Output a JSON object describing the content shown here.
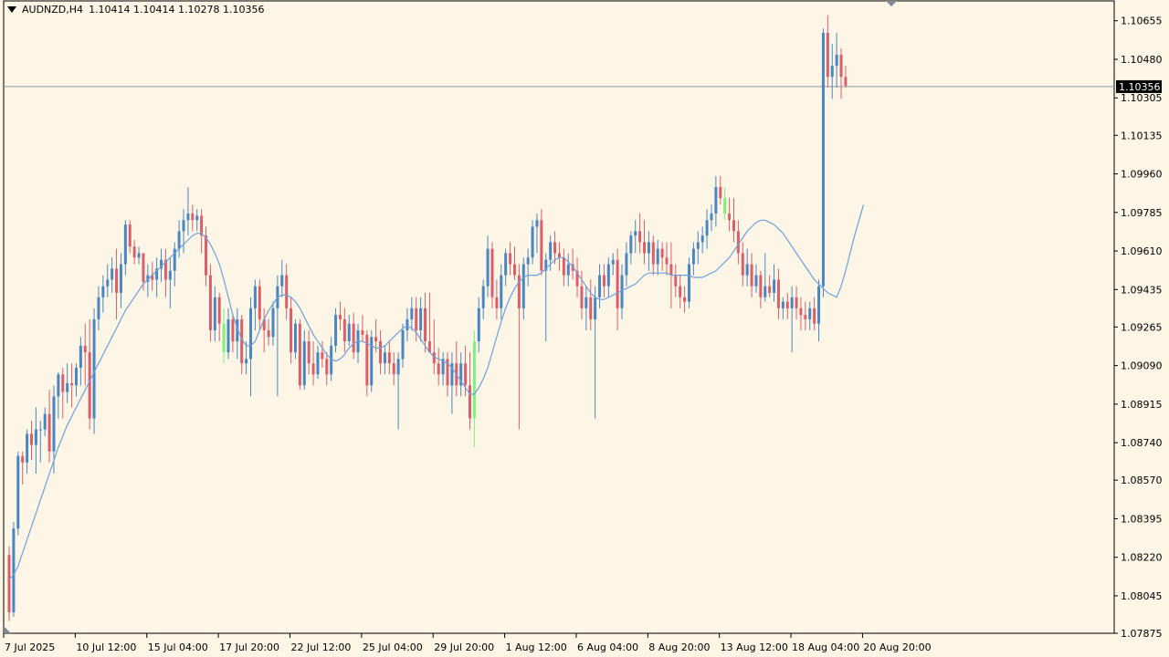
{
  "header": {
    "symbol": "AUDNZD,H4",
    "ohlc": "1.10414 1.10414 1.10278 1.10356"
  },
  "colors": {
    "background": "#fdf5e6",
    "bull": "#4a86c0",
    "bear": "#d9606a",
    "highlight": "#7ef07e",
    "ma_line": "#6fa0dc",
    "price_line": "#8a9aa8"
  },
  "chart_data": {
    "type": "candlestick",
    "title": "AUDNZD,H4",
    "current_price": "1.10356",
    "ylim": [
      1.07875,
      1.10745
    ],
    "y_ticks": [
      "1.10655",
      "1.10480",
      "1.10305",
      "1.10135",
      "1.09960",
      "1.09785",
      "1.09610",
      "1.09435",
      "1.09265",
      "1.09090",
      "1.08915",
      "1.08740",
      "1.08570",
      "1.08395",
      "1.08220",
      "1.08045",
      "1.07875"
    ],
    "x_tick_labels": [
      "7 Jul 2025",
      "10 Jul 12:00",
      "15 Jul 04:00",
      "17 Jul 20:00",
      "22 Jul 12:00",
      "25 Jul 04:00",
      "29 Jul 20:00",
      "1 Aug 12:00",
      "6 Aug 04:00",
      "8 Aug 20:00",
      "13 Aug 12:00",
      "18 Aug 04:00",
      "20 Aug 20:00"
    ],
    "x_tick_bars": [
      0,
      16,
      32,
      48,
      64,
      80,
      96,
      112,
      128,
      144,
      160,
      176,
      192
    ],
    "candles": [
      [
        1.0823,
        1.0827,
        1.0793,
        1.0797
      ],
      [
        1.0797,
        1.0838,
        1.0795,
        1.0835
      ],
      [
        1.0835,
        1.087,
        1.0832,
        1.0868
      ],
      [
        1.0868,
        1.087,
        1.0855,
        1.0865
      ],
      [
        1.0865,
        1.088,
        1.086,
        1.0878
      ],
      [
        1.0878,
        1.0884,
        1.0866,
        1.0873
      ],
      [
        1.0873,
        1.089,
        1.086,
        1.088
      ],
      [
        1.088,
        1.0884,
        1.0865,
        1.088
      ],
      [
        1.088,
        1.089,
        1.0877,
        1.0887
      ],
      [
        1.0887,
        1.0898,
        1.0865,
        1.087
      ],
      [
        1.087,
        1.09,
        1.086,
        1.0895
      ],
      [
        1.0895,
        1.0906,
        1.0885,
        1.0905
      ],
      [
        1.0905,
        1.0908,
        1.0885,
        1.0897
      ],
      [
        1.0897,
        1.091,
        1.0892,
        1.0901
      ],
      [
        1.0901,
        1.091,
        1.089,
        1.09
      ],
      [
        1.09,
        1.091,
        1.0895,
        1.0908
      ],
      [
        1.0908,
        1.0922,
        1.09,
        1.0918
      ],
      [
        1.0918,
        1.0928,
        1.09,
        1.0915
      ],
      [
        1.0915,
        1.093,
        1.088,
        1.0885
      ],
      [
        1.0885,
        1.0935,
        1.0878,
        1.093
      ],
      [
        1.093,
        1.0945,
        1.0925,
        1.094
      ],
      [
        1.094,
        1.095,
        1.0933,
        1.0945
      ],
      [
        1.0945,
        1.0955,
        1.094,
        1.0948
      ],
      [
        1.0948,
        1.0958,
        1.0942,
        1.0953
      ],
      [
        1.0953,
        1.0962,
        1.093,
        1.0942
      ],
      [
        1.0942,
        1.096,
        1.0935,
        1.0955
      ],
      [
        1.0955,
        1.0975,
        1.095,
        1.0973
      ],
      [
        1.0973,
        1.0975,
        1.096,
        1.0963
      ],
      [
        1.0963,
        1.0966,
        1.0955,
        1.0958
      ],
      [
        1.0958,
        1.0963,
        1.0955,
        1.096
      ],
      [
        1.096,
        1.096,
        1.0943,
        1.0947
      ],
      [
        1.0947,
        1.0955,
        1.094,
        1.095
      ],
      [
        1.095,
        1.0956,
        1.0943,
        1.0948
      ],
      [
        1.0948,
        1.0958,
        1.094,
        1.0953
      ],
      [
        1.0953,
        1.0962,
        1.0947,
        1.0957
      ],
      [
        1.0957,
        1.0962,
        1.094,
        1.0948
      ],
      [
        1.0948,
        1.0958,
        1.0935,
        1.0952
      ],
      [
        1.0952,
        1.0965,
        1.0945,
        1.0962
      ],
      [
        1.0962,
        1.0975,
        1.0958,
        1.097
      ],
      [
        1.097,
        1.098,
        1.096,
        1.0975
      ],
      [
        1.0975,
        1.099,
        1.0968,
        1.0978
      ],
      [
        1.0978,
        1.0982,
        1.097,
        1.0975
      ],
      [
        1.0975,
        1.098,
        1.097,
        1.0977
      ],
      [
        1.0977,
        1.098,
        1.096,
        1.0968
      ],
      [
        1.0968,
        1.0972,
        1.0945,
        1.095
      ],
      [
        1.095,
        1.0955,
        1.092,
        1.0925
      ],
      [
        1.0925,
        1.0945,
        1.092,
        1.094
      ],
      [
        1.094,
        1.0942,
        1.092,
        1.0928
      ],
      [
        1.0928,
        1.0935,
        1.091,
        1.0915
      ],
      [
        1.0915,
        1.0935,
        1.0912,
        1.093
      ],
      [
        1.093,
        1.0932,
        1.0915,
        1.092
      ],
      [
        1.092,
        1.0935,
        1.0912,
        1.093
      ],
      [
        1.093,
        1.0932,
        1.0905,
        1.091
      ],
      [
        1.091,
        1.092,
        1.0905,
        1.0912
      ],
      [
        1.0912,
        1.094,
        1.0895,
        1.0935
      ],
      [
        1.0935,
        1.0948,
        1.0925,
        1.0945
      ],
      [
        1.0945,
        1.0948,
        1.0925,
        1.093
      ],
      [
        1.093,
        1.0935,
        1.0915,
        1.0925
      ],
      [
        1.0925,
        1.093,
        1.0918,
        1.0922
      ],
      [
        1.0922,
        1.0938,
        1.0918,
        1.0935
      ],
      [
        1.0935,
        1.095,
        1.0895,
        1.0945
      ],
      [
        1.0945,
        1.0957,
        1.094,
        1.095
      ],
      [
        1.095,
        1.0955,
        1.093,
        1.0935
      ],
      [
        1.0935,
        1.094,
        1.091,
        1.0915
      ],
      [
        1.0915,
        1.093,
        1.0912,
        1.0928
      ],
      [
        1.0928,
        1.093,
        1.0898,
        1.09
      ],
      [
        1.09,
        1.0925,
        1.0898,
        1.092
      ],
      [
        1.092,
        1.0925,
        1.0905,
        1.091
      ],
      [
        1.091,
        1.092,
        1.09,
        1.0905
      ],
      [
        1.0905,
        1.0918,
        1.0903,
        1.0915
      ],
      [
        1.0915,
        1.092,
        1.0908,
        1.0912
      ],
      [
        1.0912,
        1.0915,
        1.09,
        1.0905
      ],
      [
        1.0905,
        1.0922,
        1.0902,
        1.0918
      ],
      [
        1.0918,
        1.0935,
        1.0915,
        1.0932
      ],
      [
        1.0932,
        1.0938,
        1.0925,
        1.093
      ],
      [
        1.093,
        1.0935,
        1.0915,
        1.092
      ],
      [
        1.092,
        1.0932,
        1.0918,
        1.0928
      ],
      [
        1.0928,
        1.0933,
        1.0912,
        1.0915
      ],
      [
        1.0915,
        1.0928,
        1.091,
        1.0925
      ],
      [
        1.0925,
        1.0932,
        1.092,
        1.0923
      ],
      [
        1.0923,
        1.0925,
        1.0895,
        1.09
      ],
      [
        1.09,
        1.0925,
        1.0897,
        1.0922
      ],
      [
        1.0922,
        1.093,
        1.0915,
        1.092
      ],
      [
        1.092,
        1.0925,
        1.0905,
        1.091
      ],
      [
        1.091,
        1.0918,
        1.0905,
        1.0915
      ],
      [
        1.0915,
        1.092,
        1.0905,
        1.091
      ],
      [
        1.091,
        1.0915,
        1.09,
        1.0905
      ],
      [
        1.0905,
        1.0915,
        1.088,
        1.0912
      ],
      [
        1.0912,
        1.0928,
        1.0908,
        1.0925
      ],
      [
        1.0925,
        1.0935,
        1.092,
        1.093
      ],
      [
        1.093,
        1.094,
        1.0925,
        1.0935
      ],
      [
        1.0935,
        1.094,
        1.092,
        1.0925
      ],
      [
        1.0925,
        1.094,
        1.092,
        1.0935
      ],
      [
        1.0935,
        1.0942,
        1.0915,
        1.092
      ],
      [
        1.092,
        1.0942,
        1.0915,
        1.0915
      ],
      [
        1.0915,
        1.093,
        1.0905,
        1.091
      ],
      [
        1.091,
        1.0917,
        1.09,
        1.0905
      ],
      [
        1.0905,
        1.0915,
        1.09,
        1.0912
      ],
      [
        1.0912,
        1.0915,
        1.0895,
        1.09
      ],
      [
        1.09,
        1.0915,
        1.0887,
        1.091
      ],
      [
        1.091,
        1.092,
        1.0895,
        1.09
      ],
      [
        1.09,
        1.0915,
        1.0895,
        1.091
      ],
      [
        1.091,
        1.0918,
        1.0895,
        1.09
      ],
      [
        1.09,
        1.0915,
        1.088,
        1.0885
      ],
      [
        1.0885,
        1.0925,
        1.0872,
        1.092
      ],
      [
        1.092,
        1.094,
        1.0915,
        1.0935
      ],
      [
        1.0935,
        1.0948,
        1.093,
        1.0945
      ],
      [
        1.0945,
        1.0968,
        1.094,
        1.0962
      ],
      [
        1.0962,
        1.0965,
        1.0935,
        1.094
      ],
      [
        1.094,
        1.0948,
        1.093,
        1.0935
      ],
      [
        1.0935,
        1.0955,
        1.093,
        1.095
      ],
      [
        1.095,
        1.0962,
        1.0945,
        1.096
      ],
      [
        1.096,
        1.0965,
        1.095,
        1.0955
      ],
      [
        1.0955,
        1.0963,
        1.0948,
        1.095
      ],
      [
        1.095,
        1.0955,
        1.088,
        1.0935
      ],
      [
        1.0935,
        1.0958,
        1.093,
        1.0955
      ],
      [
        1.0955,
        1.0962,
        1.0945,
        1.0958
      ],
      [
        1.0958,
        1.0975,
        1.0955,
        1.0972
      ],
      [
        1.0972,
        1.0978,
        1.096,
        1.0975
      ],
      [
        1.0975,
        1.098,
        1.095,
        1.0952
      ],
      [
        1.0952,
        1.096,
        1.092,
        1.0957
      ],
      [
        1.0957,
        1.0968,
        1.0952,
        1.0965
      ],
      [
        1.0965,
        1.097,
        1.0955,
        1.096
      ],
      [
        1.096,
        1.0965,
        1.0952,
        1.0958
      ],
      [
        1.0958,
        1.0962,
        1.0945,
        1.095
      ],
      [
        1.095,
        1.096,
        1.0945,
        1.0955
      ],
      [
        1.0955,
        1.0962,
        1.0948,
        1.0952
      ],
      [
        1.0952,
        1.0958,
        1.094,
        1.0945
      ],
      [
        1.0945,
        1.0952,
        1.093,
        1.0935
      ],
      [
        1.0935,
        1.0945,
        1.0925,
        1.094
      ],
      [
        1.094,
        1.0948,
        1.0925,
        1.093
      ],
      [
        1.093,
        1.0945,
        1.0885,
        1.094
      ],
      [
        1.094,
        1.0955,
        1.0935,
        1.095
      ],
      [
        1.095,
        1.0955,
        1.094,
        1.0945
      ],
      [
        1.0945,
        1.0958,
        1.094,
        1.0955
      ],
      [
        1.0955,
        1.096,
        1.095,
        1.0957
      ],
      [
        1.0957,
        1.0962,
        1.0925,
        1.0935
      ],
      [
        1.0935,
        1.0955,
        1.093,
        1.095
      ],
      [
        1.095,
        1.0965,
        1.0945,
        1.096
      ],
      [
        1.096,
        1.097,
        1.0955,
        1.0968
      ],
      [
        1.0968,
        1.0975,
        1.096,
        1.097
      ],
      [
        1.097,
        1.0978,
        1.096,
        1.0965
      ],
      [
        1.0965,
        1.0975,
        1.0955,
        1.096
      ],
      [
        1.096,
        1.097,
        1.0952,
        1.0965
      ],
      [
        1.0965,
        1.0968,
        1.095,
        1.0955
      ],
      [
        1.0955,
        1.0966,
        1.095,
        1.0962
      ],
      [
        1.0962,
        1.0965,
        1.0952,
        1.0958
      ],
      [
        1.0958,
        1.0965,
        1.095,
        1.0955
      ],
      [
        1.0955,
        1.0965,
        1.0935,
        1.095
      ],
      [
        1.095,
        1.0955,
        1.094,
        1.0945
      ],
      [
        1.0945,
        1.095,
        1.0935,
        1.094
      ],
      [
        1.094,
        1.0945,
        1.0933,
        1.0938
      ],
      [
        1.0938,
        1.0958,
        1.0935,
        1.0955
      ],
      [
        1.0955,
        1.0965,
        1.095,
        1.0962
      ],
      [
        1.0962,
        1.097,
        1.0955,
        1.0965
      ],
      [
        1.0965,
        1.0972,
        1.096,
        1.0968
      ],
      [
        1.0968,
        1.098,
        1.0962,
        1.0975
      ],
      [
        1.0975,
        1.0982,
        1.097,
        1.0978
      ],
      [
        1.0978,
        1.0995,
        1.0972,
        1.099
      ],
      [
        1.099,
        1.0995,
        1.0982,
        1.0985
      ],
      [
        1.0985,
        1.099,
        1.0975,
        1.0978
      ],
      [
        1.0978,
        1.0985,
        1.097,
        1.0975
      ],
      [
        1.0975,
        1.0985,
        1.0965,
        1.097
      ],
      [
        1.097,
        1.0975,
        1.0955,
        1.096
      ],
      [
        1.096,
        1.0965,
        1.0945,
        1.095
      ],
      [
        1.095,
        1.0962,
        1.0945,
        1.0955
      ],
      [
        1.0955,
        1.096,
        1.094,
        1.0945
      ],
      [
        1.0945,
        1.0955,
        1.0942,
        1.095
      ],
      [
        1.095,
        1.0952,
        1.0935,
        1.094
      ],
      [
        1.094,
        1.096,
        1.0938,
        1.0945
      ],
      [
        1.0945,
        1.095,
        1.094,
        1.0942
      ],
      [
        1.0942,
        1.0955,
        1.0938,
        1.0948
      ],
      [
        1.0948,
        1.0953,
        1.093,
        1.0935
      ],
      [
        1.0935,
        1.094,
        1.093,
        1.0938
      ],
      [
        1.0938,
        1.0942,
        1.093,
        1.0935
      ],
      [
        1.0935,
        1.0945,
        1.0915,
        1.094
      ],
      [
        1.094,
        1.0945,
        1.093,
        1.0935
      ],
      [
        1.0935,
        1.094,
        1.0925,
        1.0932
      ],
      [
        1.0932,
        1.0938,
        1.0925,
        1.093
      ],
      [
        1.093,
        1.0938,
        1.0925,
        1.0935
      ],
      [
        1.0935,
        1.094,
        1.0925,
        1.0928
      ],
      [
        1.0928,
        1.0948,
        1.092,
        1.0945
      ],
      [
        1.0945,
        1.1062,
        1.094,
        1.106
      ],
      [
        1.106,
        1.1068,
        1.1035,
        1.104
      ],
      [
        1.104,
        1.1055,
        1.103,
        1.1045
      ],
      [
        1.1045,
        1.106,
        1.1035,
        1.105
      ],
      [
        1.105,
        1.1053,
        1.103,
        1.104
      ],
      [
        1.104,
        1.1045,
        1.1035,
        1.1036
      ]
    ],
    "highlight_bars": [
      48,
      104,
      160
    ],
    "ma_values": [
      1.0812,
      1.0814,
      1.0818,
      1.0824,
      1.083,
      1.0836,
      1.0842,
      1.0848,
      1.0854,
      1.086,
      1.0866,
      1.0872,
      1.0877,
      1.0882,
      1.0886,
      1.089,
      1.0894,
      1.0898,
      1.0902,
      1.0906,
      1.091,
      1.0914,
      1.0918,
      1.0922,
      1.0926,
      1.093,
      1.0934,
      1.0937,
      1.094,
      1.0943,
      1.0946,
      1.0948,
      1.095,
      1.0952,
      1.0954,
      1.0956,
      1.0958,
      1.096,
      1.0962,
      1.0964,
      1.0966,
      1.0968,
      1.0969,
      1.0969,
      1.0967,
      1.0964,
      1.096,
      1.0955,
      1.0948,
      1.094,
      1.0932,
      1.0926,
      1.0921,
      1.0918,
      1.0918,
      1.092,
      1.0925,
      1.093,
      1.0934,
      1.0937,
      1.094,
      1.0941,
      1.0941,
      1.094,
      1.0938,
      1.0935,
      1.0931,
      1.0927,
      1.0923,
      1.092,
      1.0917,
      1.0914,
      1.0912,
      1.0911,
      1.0912,
      1.0914,
      1.0917,
      1.0919,
      1.092,
      1.092,
      1.0919,
      1.0918,
      1.0917,
      1.0917,
      1.0918,
      1.092,
      1.0922,
      1.0924,
      1.0926,
      1.0927,
      1.0926,
      1.0924,
      1.0921,
      1.0918,
      1.0915,
      1.0913,
      1.0912,
      1.0911,
      1.091,
      1.0908,
      1.0905,
      1.0902,
      1.0899,
      1.0896,
      1.0896,
      1.0899,
      1.0903,
      1.0908,
      1.0915,
      1.0922,
      1.0929,
      1.0935,
      1.094,
      1.0944,
      1.0947,
      1.0949,
      1.095,
      1.095,
      1.095,
      1.0951,
      1.0953,
      1.0955,
      1.0957,
      1.0958,
      1.0958,
      1.0956,
      1.0954,
      1.0951,
      1.0948,
      1.0945,
      1.0942,
      1.094,
      1.0939,
      1.0939,
      1.094,
      1.0941,
      1.0942,
      1.0943,
      1.0944,
      1.0945,
      1.0946,
      1.0948,
      1.095,
      1.0951,
      1.0951,
      1.0951,
      1.0951,
      1.0951,
      1.095,
      1.095,
      1.095,
      1.095,
      1.095,
      1.0949,
      1.0949,
      1.0949,
      1.095,
      1.0951,
      1.0952,
      1.0954,
      1.0956,
      1.0958,
      1.0961,
      1.0964,
      1.0967,
      1.097,
      1.0972,
      1.0974,
      1.0975,
      1.0975,
      1.0974,
      1.0973,
      1.0971,
      1.0969,
      1.0966,
      1.0963,
      1.096,
      1.0957,
      1.0954,
      1.0951,
      1.0948,
      1.0946,
      1.0944,
      1.0942,
      1.0941,
      1.094,
      1.0945,
      1.0952,
      1.096,
      1.0968,
      1.0975,
      1.0982
    ],
    "x_axis_labels_note": ""
  }
}
